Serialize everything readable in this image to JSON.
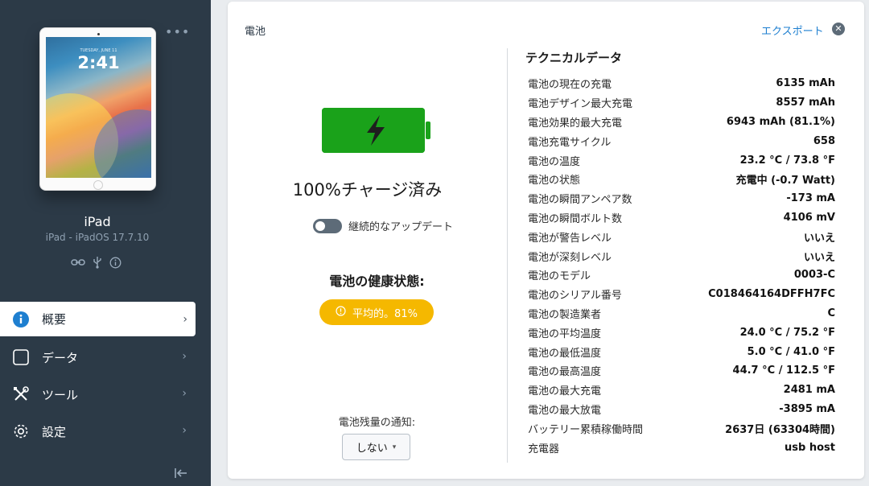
{
  "device": {
    "lock_date": "TUESDAY, JUNE 11",
    "lock_time": "2:41",
    "name": "iPad",
    "subtitle": "iPad - iPadOS 17.7.10"
  },
  "sidebar": {
    "more_label": "•••",
    "nav": [
      {
        "label": "概要",
        "icon": "info-icon",
        "active": true
      },
      {
        "label": "データ",
        "icon": "square-icon",
        "active": false
      },
      {
        "label": "ツール",
        "icon": "tools-icon",
        "active": false
      },
      {
        "label": "設定",
        "icon": "gear-icon",
        "active": false
      }
    ]
  },
  "card": {
    "title": "電池",
    "export_label": "エクスポート",
    "close_label": "✕"
  },
  "battery": {
    "level_fraction": 1.0,
    "fill_color": "#1aa21a",
    "charge_text": "100%チャージ済み",
    "continuous_update_label": "継続的なアップデート",
    "continuous_update_on": false,
    "health_label": "電池の健康状態:",
    "health_badge": "平均的。81%",
    "health_color": "#f5b800",
    "notify_label": "電池残量の通知:",
    "notify_value": "しない"
  },
  "tech": {
    "title": "テクニカルデータ",
    "rows": [
      {
        "label": "電池の現在の充電",
        "value": "6135 mAh"
      },
      {
        "label": "電池デザイン最大充電",
        "value": "8557 mAh"
      },
      {
        "label": "電池効果的最大充電",
        "value": "6943 mAh (81.1%)"
      },
      {
        "label": "電池充電サイクル",
        "value": "658"
      },
      {
        "label": "電池の温度",
        "value": "23.2 °C / 73.8 °F"
      },
      {
        "label": "電池の状態",
        "value": "充電中 (-0.7 Watt)"
      },
      {
        "label": "電池の瞬間アンペア数",
        "value": "-173 mA"
      },
      {
        "label": "電池の瞬間ボルト数",
        "value": "4106 mV"
      },
      {
        "label": "電池が警告レベル",
        "value": "いいえ"
      },
      {
        "label": "電池が深刻レベル",
        "value": "いいえ"
      },
      {
        "label": "電池のモデル",
        "value": "0003-C"
      },
      {
        "label": "電池のシリアル番号",
        "value": "C018464164DFFH7FC"
      },
      {
        "label": "電池の製造業者",
        "value": "C"
      },
      {
        "label": "電池の平均温度",
        "value": "24.0 °C / 75.2 °F"
      },
      {
        "label": "電池の最低温度",
        "value": "5.0 °C / 41.0 °F"
      },
      {
        "label": "電池の最高温度",
        "value": "44.7 °C / 112.5 °F"
      },
      {
        "label": "電池の最大充電",
        "value": "2481 mA"
      },
      {
        "label": "電池の最大放電",
        "value": "-3895 mA"
      },
      {
        "label": "バッテリー累積稼働時間",
        "value": "2637日 (63304時間)"
      },
      {
        "label": "充電器",
        "value": "usb host"
      }
    ]
  }
}
